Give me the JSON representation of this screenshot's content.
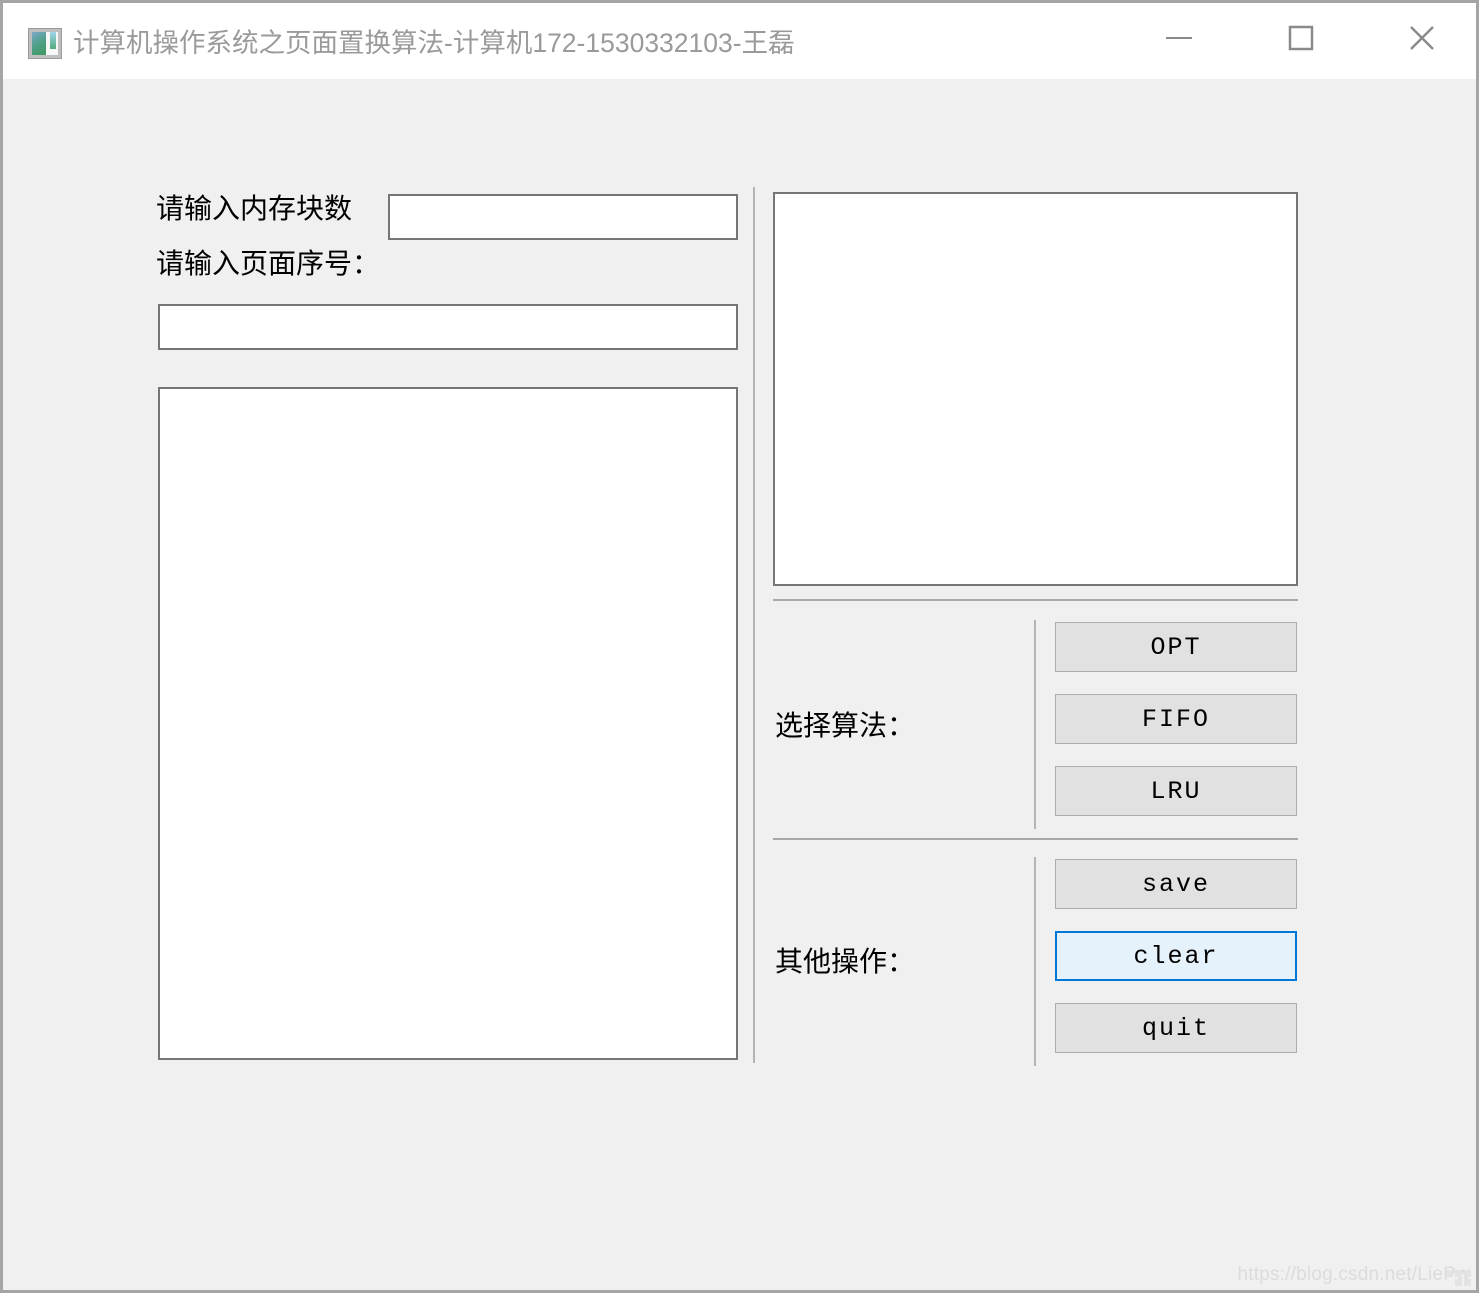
{
  "window": {
    "title": "计算机操作系统之页面置换算法-计算机172-1530332103-王磊",
    "icon": "app-image-icon",
    "controls": {
      "minimize": "minimize-icon",
      "maximize": "maximize-icon",
      "close": "close-icon"
    }
  },
  "form": {
    "memory_blocks_label": "请输入内存块数",
    "memory_blocks_value": "",
    "memory_blocks_placeholder": "",
    "page_sequence_label": "请输入页面序号：",
    "page_sequence_value": "",
    "page_sequence_placeholder": "",
    "result_area_text": ""
  },
  "output": {
    "display_area_text": ""
  },
  "algorithms": {
    "label": "选择算法：",
    "buttons": [
      {
        "label": "OPT",
        "focused": false
      },
      {
        "label": "FIFO",
        "focused": false
      },
      {
        "label": "LRU",
        "focused": false
      }
    ]
  },
  "operations": {
    "label": "其他操作：",
    "buttons": [
      {
        "label": "save",
        "focused": false
      },
      {
        "label": "clear",
        "focused": true
      },
      {
        "label": "quit",
        "focused": false
      }
    ]
  },
  "watermark": {
    "text": "https://blog.csdn.net/LiePw"
  },
  "colors": {
    "accent": "#0078d7",
    "accent_fill": "#e5f1fb",
    "window_bg": "#f0f0f0",
    "field_border": "#767676",
    "button_bg": "#e1e1e1",
    "button_border": "#adadad",
    "title_text": "#9a9a9a"
  }
}
